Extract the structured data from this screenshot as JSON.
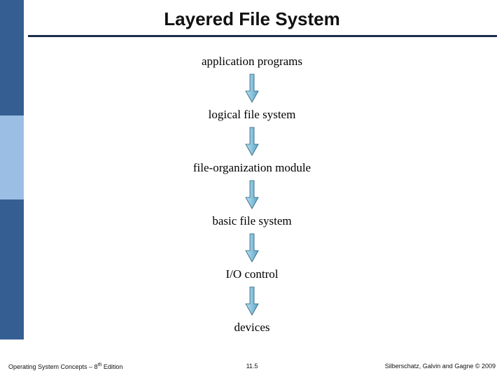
{
  "title": "Layered File System",
  "layers": [
    "application programs",
    "logical file system",
    "file-organization module",
    "basic file system",
    "I/O control",
    "devices"
  ],
  "footer": {
    "leftPrefix": "Operating System Concepts – 8",
    "leftSup": "th",
    "leftSuffix": " Edition",
    "center": "11.5",
    "right": "Silberschatz, Galvin and Gagne © 2009"
  },
  "colors": {
    "sidebarDark": "#355f93",
    "sidebarLight": "#9bbfe4",
    "rule": "#1c2d4a",
    "arrowLight": "#b7dff1",
    "arrowDark": "#5da7c9",
    "arrowStroke": "#2b5f7a"
  }
}
